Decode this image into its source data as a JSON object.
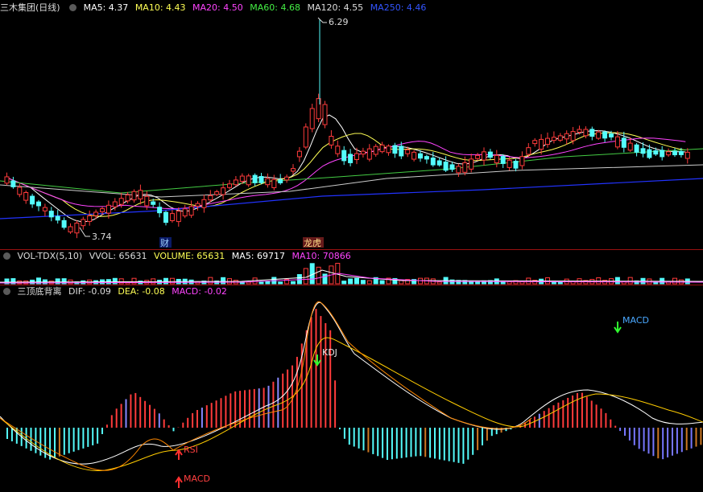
{
  "price_panel": {
    "stock_title": "三木集团(日线)",
    "ma_labels": [
      {
        "text": "MA5: 4.37",
        "color": "#ffffff"
      },
      {
        "text": "MA10: 4.43",
        "color": "#ffff55"
      },
      {
        "text": "MA20: 4.50",
        "color": "#ff44ff"
      },
      {
        "text": "MA60: 4.68",
        "color": "#44ee44"
      },
      {
        "text": "MA120: 4.55",
        "color": "#dddddd"
      },
      {
        "text": "MA250: 4.46",
        "color": "#3355ff"
      }
    ],
    "high_annotation": "6.29",
    "low_annotation": "3.74",
    "marker_cai": "财",
    "marker_longhu": "龙虎"
  },
  "volume_panel": {
    "labels": [
      {
        "text": "VOL-TDX(5,10)",
        "color": "#dddddd"
      },
      {
        "text": "VVOL: 65631",
        "color": "#dddddd"
      },
      {
        "text": "VOLUME: 65631",
        "color": "#ffff55"
      },
      {
        "text": "MA5: 69717",
        "color": "#ffffff"
      },
      {
        "text": "MA10: 70866",
        "color": "#ff44ff"
      }
    ]
  },
  "macd_panel": {
    "labels": [
      {
        "text": "三顶底背离",
        "color": "#dddddd"
      },
      {
        "text": "DIF: -0.09",
        "color": "#dddddd"
      },
      {
        "text": "DEA: -0.08",
        "color": "#ffff55"
      },
      {
        "text": "MACD: -0.02",
        "color": "#ff44ff"
      }
    ],
    "signals": [
      {
        "text": "RSI",
        "dir": "up"
      },
      {
        "text": "MACD",
        "dir": "up"
      },
      {
        "text": "KDJ",
        "dir": "down"
      },
      {
        "text": "MACD",
        "dir": "down"
      }
    ]
  },
  "colors": {
    "up": "#ff3b3b",
    "down": "#54fcfc",
    "separator": "#9a1010"
  }
}
